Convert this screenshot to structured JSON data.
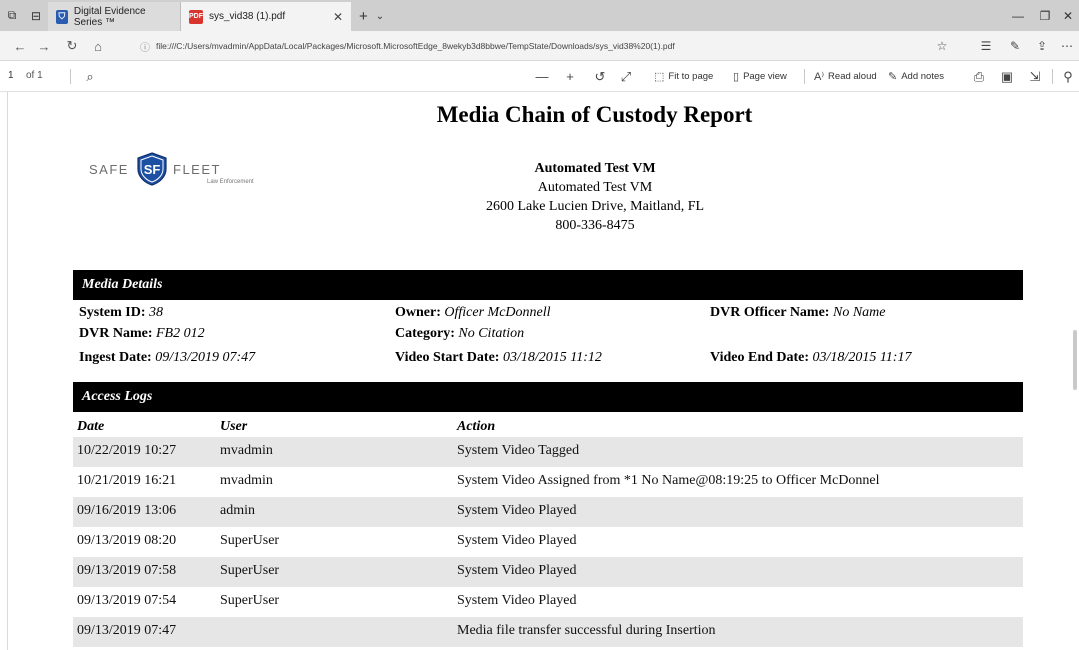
{
  "browser": {
    "tabs": [
      {
        "label": "Digital Evidence Series ™",
        "icon": "shield-icon"
      },
      {
        "label": "sys_vid38 (1).pdf",
        "icon": "pdf-icon"
      }
    ],
    "url": "file:///C:/Users/mvadmin/AppData/Local/Packages/Microsoft.MicrosoftEdge_8wekyb3d8bbwe/TempState/Downloads/sys_vid38%20(1).pdf"
  },
  "pdf_toolbar": {
    "page_number": "1",
    "page_total": "of 1",
    "fit_to_page": "Fit to page",
    "page_view": "Page view",
    "read_aloud": "Read aloud",
    "add_notes": "Add notes"
  },
  "report": {
    "title": "Media Chain of Custody Report",
    "logo": {
      "left": "SAFE",
      "right": "FLEET",
      "sub": "Law Enforcement",
      "mark": "SF"
    },
    "org_name_bold": "Automated Test VM",
    "org_name": "Automated Test VM",
    "address": "2600 Lake Lucien Drive, Maitland, FL",
    "phone": "800-336-8475"
  },
  "media_details": {
    "heading": "Media Details",
    "system_id": {
      "label": "System ID:",
      "value": "38"
    },
    "owner": {
      "label": "Owner:",
      "value": "Officer McDonnell"
    },
    "dvr_officer": {
      "label": "DVR Officer Name:",
      "value": "No Name"
    },
    "dvr_name": {
      "label": "DVR Name:",
      "value": "FB2 012"
    },
    "category": {
      "label": "Category:",
      "value": "No Citation"
    },
    "ingest_date": {
      "label": "Ingest Date:",
      "value": "09/13/2019 07:47"
    },
    "video_start": {
      "label": "Video Start Date:",
      "value": "03/18/2015 11:12"
    },
    "video_end": {
      "label": "Video End Date:",
      "value": "03/18/2015 11:17"
    }
  },
  "access_logs": {
    "heading": "Access Logs",
    "columns": {
      "date": "Date",
      "user": "User",
      "action": "Action"
    },
    "rows": [
      {
        "date": "10/22/2019 10:27",
        "user": "mvadmin",
        "action": "System Video Tagged"
      },
      {
        "date": "10/21/2019 16:21",
        "user": "mvadmin",
        "action": "System Video Assigned from *1 No Name@08:19:25 to Officer McDonnel"
      },
      {
        "date": "09/16/2019 13:06",
        "user": "admin",
        "action": "System Video Played"
      },
      {
        "date": "09/13/2019 08:20",
        "user": "SuperUser",
        "action": "System Video Played"
      },
      {
        "date": "09/13/2019 07:58",
        "user": "SuperUser",
        "action": "System Video Played"
      },
      {
        "date": "09/13/2019 07:54",
        "user": "SuperUser",
        "action": "System Video Played"
      },
      {
        "date": "09/13/2019 07:47",
        "user": "",
        "action": "Media file transfer successful during Insertion"
      }
    ]
  },
  "colors": {
    "section_bar": "#000000",
    "row_shade": "#e6e6e6",
    "logo_blue": "#1d4fa3",
    "pdf_red": "#d7352e"
  }
}
